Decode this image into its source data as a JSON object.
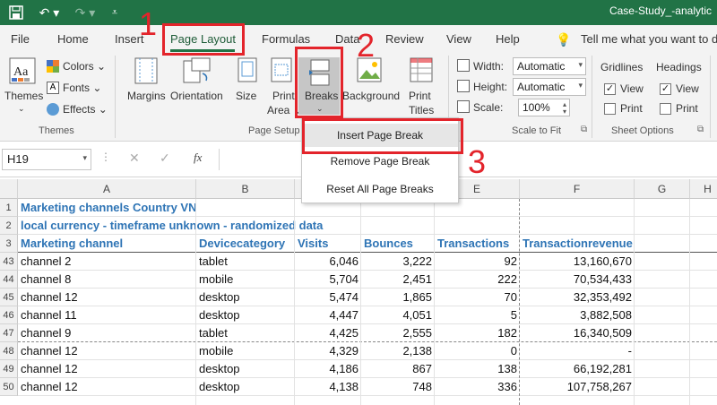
{
  "window": {
    "title": "Case-Study_-analytic"
  },
  "tabs": [
    "File",
    "Home",
    "Insert",
    "Page Layout",
    "Formulas",
    "Data",
    "Review",
    "View",
    "Help"
  ],
  "tell_me": "Tell me what you want to d",
  "ribbon": {
    "themes": {
      "themes_label": "Themes",
      "colors_label": "Colors",
      "fonts_label": "Fonts",
      "effects_label": "Effects",
      "group_label": "Themes"
    },
    "page_setup": {
      "margins": "Margins",
      "orientation": "Orientation",
      "size": "Size",
      "print_area_1": "Print",
      "print_area_2": "Area",
      "breaks": "Breaks",
      "background": "Background",
      "print_titles_1": "Print",
      "print_titles_2": "Titles",
      "group_label": "Page Setup"
    },
    "scale_to_fit": {
      "width_label": "Width:",
      "width_value": "Automatic",
      "height_label": "Height:",
      "height_value": "Automatic",
      "scale_label": "Scale:",
      "scale_value": "100%",
      "group_label": "Scale to Fit"
    },
    "sheet_options": {
      "gridlines": "Gridlines",
      "headings": "Headings",
      "view": "View",
      "print": "Print",
      "group_label": "Sheet Options"
    }
  },
  "breaks_menu": [
    "Insert Page Break",
    "Remove Page Break",
    "Reset All Page Breaks"
  ],
  "formula_bar": {
    "name_box": "H19",
    "fx": "fx"
  },
  "annotations": [
    "1",
    "2",
    "3"
  ],
  "columns": [
    "A",
    "B",
    "C",
    "D",
    "E",
    "F",
    "G",
    "H"
  ],
  "sheet": {
    "title_row1": "Marketing channels Country VN",
    "title_row2": "local currency - timeframe unknown - randomized data",
    "headers": [
      "Marketing channel",
      "Devicecategory",
      "Visits",
      "Bounces",
      "Transactions",
      "Transactionrevenue"
    ],
    "rows": [
      {
        "num": "43",
        "cells": [
          "channel 2",
          "tablet",
          "6,046",
          "3,222",
          "92",
          "13,160,670"
        ]
      },
      {
        "num": "44",
        "cells": [
          "channel 8",
          "mobile",
          "5,704",
          "2,451",
          "222",
          "70,534,433"
        ]
      },
      {
        "num": "45",
        "cells": [
          "channel 12",
          "desktop",
          "5,474",
          "1,865",
          "70",
          "32,353,492"
        ]
      },
      {
        "num": "46",
        "cells": [
          "channel 11",
          "desktop",
          "4,447",
          "4,051",
          "5",
          "3,882,508"
        ]
      },
      {
        "num": "47",
        "cells": [
          "channel 9",
          "tablet",
          "4,425",
          "2,555",
          "182",
          "16,340,509"
        ]
      },
      {
        "num": "48",
        "cells": [
          "channel 12",
          "mobile",
          "4,329",
          "2,138",
          "0",
          "-"
        ]
      },
      {
        "num": "49",
        "cells": [
          "channel 12",
          "desktop",
          "4,186",
          "867",
          "138",
          "66,192,281"
        ]
      },
      {
        "num": "50",
        "cells": [
          "channel 12",
          "desktop",
          "4,138",
          "748",
          "336",
          "107,758,267"
        ]
      }
    ],
    "row_nums_top": [
      "1",
      "2",
      "3"
    ]
  },
  "colors": {
    "excel_green": "#217346",
    "header_blue": "#2e74b5",
    "annotation_red": "#e3242b"
  }
}
